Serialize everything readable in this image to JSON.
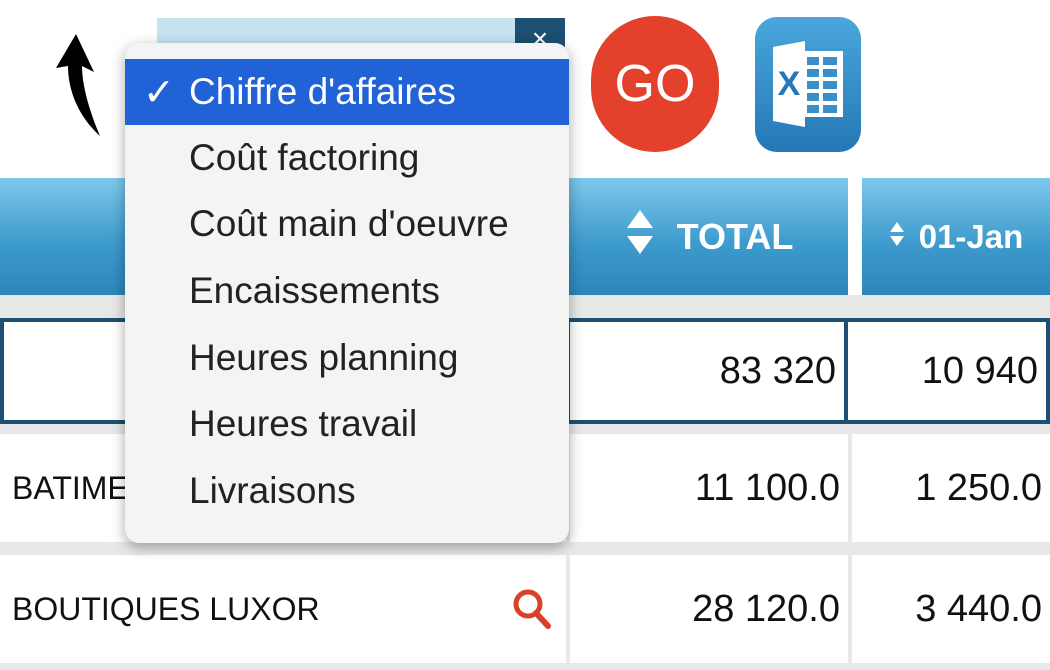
{
  "toolbar": {
    "go_label": "GO",
    "excel_icon": "excel-icon",
    "back_icon": "back-arrow-icon",
    "select_icon": "close-icon",
    "select_glyph": "×"
  },
  "dropdown": {
    "options": [
      {
        "label": "Chiffre d'affaires",
        "selected": true
      },
      {
        "label": "Coût factoring",
        "selected": false
      },
      {
        "label": "Coût main d'oeuvre",
        "selected": false
      },
      {
        "label": "Encaissements",
        "selected": false
      },
      {
        "label": "Heures planning",
        "selected": false
      },
      {
        "label": "Heures travail",
        "selected": false
      },
      {
        "label": "Livraisons",
        "selected": false
      }
    ],
    "check_glyph": "✓"
  },
  "table": {
    "headers": {
      "total": "TOTAL",
      "jan": "01-Jan"
    },
    "totals": {
      "total": "83 320",
      "jan": "10 940"
    },
    "rows": [
      {
        "name": "BATIME",
        "total": "11 100.0",
        "jan": "1 250.0"
      },
      {
        "name": "BOUTIQUES LUXOR",
        "total": "28 120.0",
        "jan": "3 440.0"
      }
    ]
  },
  "colors": {
    "header_blue": "#3e9bcd",
    "dark_blue": "#1d4f72",
    "go_red": "#e4412c",
    "selected_blue": "#2162d6",
    "search_icon": "#d9402a"
  }
}
